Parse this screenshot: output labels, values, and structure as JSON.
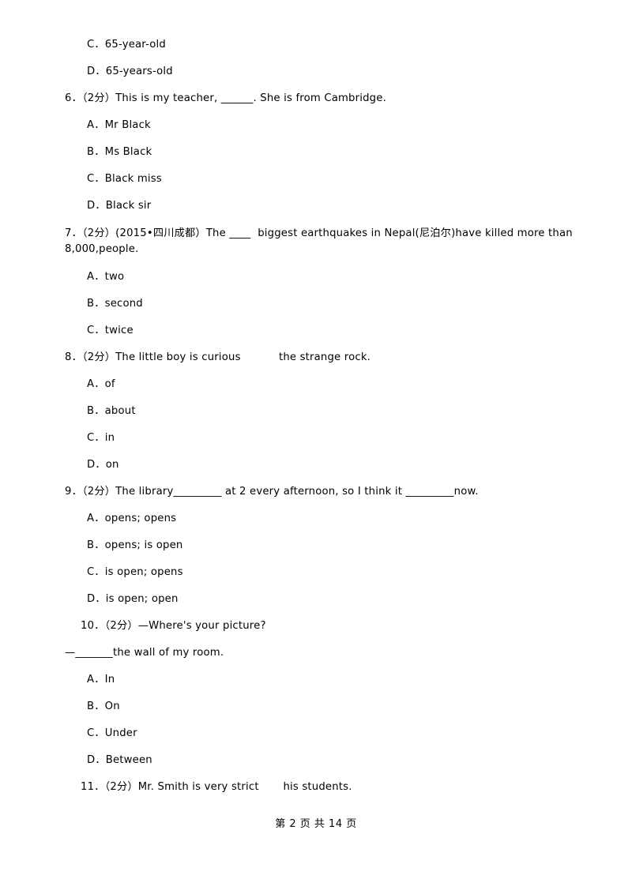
{
  "document": {
    "page_footer": "第 2 页 共 14 页",
    "lines": [
      {
        "id": "l1",
        "type": "option",
        "text": "C．65-year-old"
      },
      {
        "id": "l2",
        "type": "option",
        "text": "D．65-years-old"
      },
      {
        "id": "l3",
        "type": "stem",
        "text": "6．（2分）This is my teacher, ______. She is from Cambridge."
      },
      {
        "id": "l4",
        "type": "option",
        "text": "A．Mr Black"
      },
      {
        "id": "l5",
        "type": "option",
        "text": "B．Ms Black"
      },
      {
        "id": "l6",
        "type": "option",
        "text": "C．Black miss"
      },
      {
        "id": "l7",
        "type": "option",
        "text": "D．Black sir"
      },
      {
        "id": "l8",
        "type": "stem2",
        "text_line1": "7．（2分）(2015•四川成都）The ____  biggest earthquakes in Nepal(尼泊尔)have killed more than",
        "text_line2": "8,000,people."
      },
      {
        "id": "l9",
        "type": "option",
        "text": "A．two"
      },
      {
        "id": "l10",
        "type": "option",
        "text": "B．second"
      },
      {
        "id": "l11",
        "type": "option",
        "text": "C．twice"
      },
      {
        "id": "l12",
        "type": "stem",
        "text": "8．（2分）The little boy is curious           the strange rock."
      },
      {
        "id": "l13",
        "type": "option",
        "text": "A．of"
      },
      {
        "id": "l14",
        "type": "option",
        "text": "B．about"
      },
      {
        "id": "l15",
        "type": "option",
        "text": "C．in"
      },
      {
        "id": "l16",
        "type": "option",
        "text": "D．on"
      },
      {
        "id": "l17",
        "type": "stem",
        "text": "9．（2分）The library_________ at 2 every afternoon, so I think it _________now."
      },
      {
        "id": "l18",
        "type": "option",
        "text": "A．opens; opens"
      },
      {
        "id": "l19",
        "type": "option",
        "text": "B．opens; is open"
      },
      {
        "id": "l20",
        "type": "option",
        "text": "C．is open; opens"
      },
      {
        "id": "l21",
        "type": "option",
        "text": "D．is open; open"
      },
      {
        "id": "l22",
        "type": "stem",
        "text": "10．（2分）—Where's your picture?"
      },
      {
        "id": "l23",
        "type": "cont",
        "text": "—_______the wall of my room."
      },
      {
        "id": "l24",
        "type": "option",
        "text": "A．In"
      },
      {
        "id": "l25",
        "type": "option",
        "text": "B．On"
      },
      {
        "id": "l26",
        "type": "option",
        "text": "C．Under"
      },
      {
        "id": "l27",
        "type": "option",
        "text": "D．Between"
      },
      {
        "id": "l28",
        "type": "stem",
        "text": "11．（2分）Mr. Smith is very strict       his students."
      }
    ]
  }
}
